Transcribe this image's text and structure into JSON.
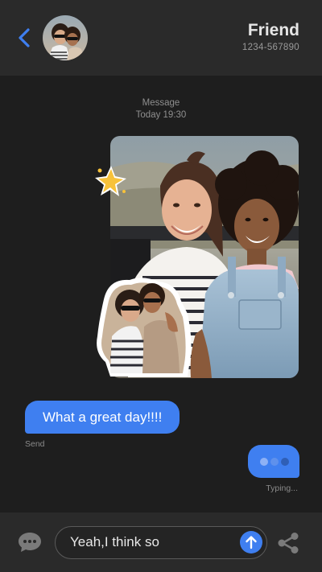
{
  "header": {
    "contact_name": "Friend",
    "contact_phone": "1234-567890",
    "back_icon": "chevron-left-icon",
    "avatar_icon": "avatar"
  },
  "thread": {
    "stamp_label": "Message",
    "stamp_time": "Today 19:30",
    "sent_message": "What a great day!!!!",
    "sent_status": "Send",
    "typing_status": "Typing..."
  },
  "composer": {
    "value": "Yeah,I think so",
    "chat_icon": "chat-bubble-icon",
    "send_icon": "arrow-up-icon",
    "share_icon": "share-icon"
  },
  "colors": {
    "background": "#1e1e1e",
    "bar": "#2a2a2a",
    "accent": "#3f7ff0",
    "back_arrow": "#3f7ff0",
    "muted_text": "#8f8f8f"
  }
}
